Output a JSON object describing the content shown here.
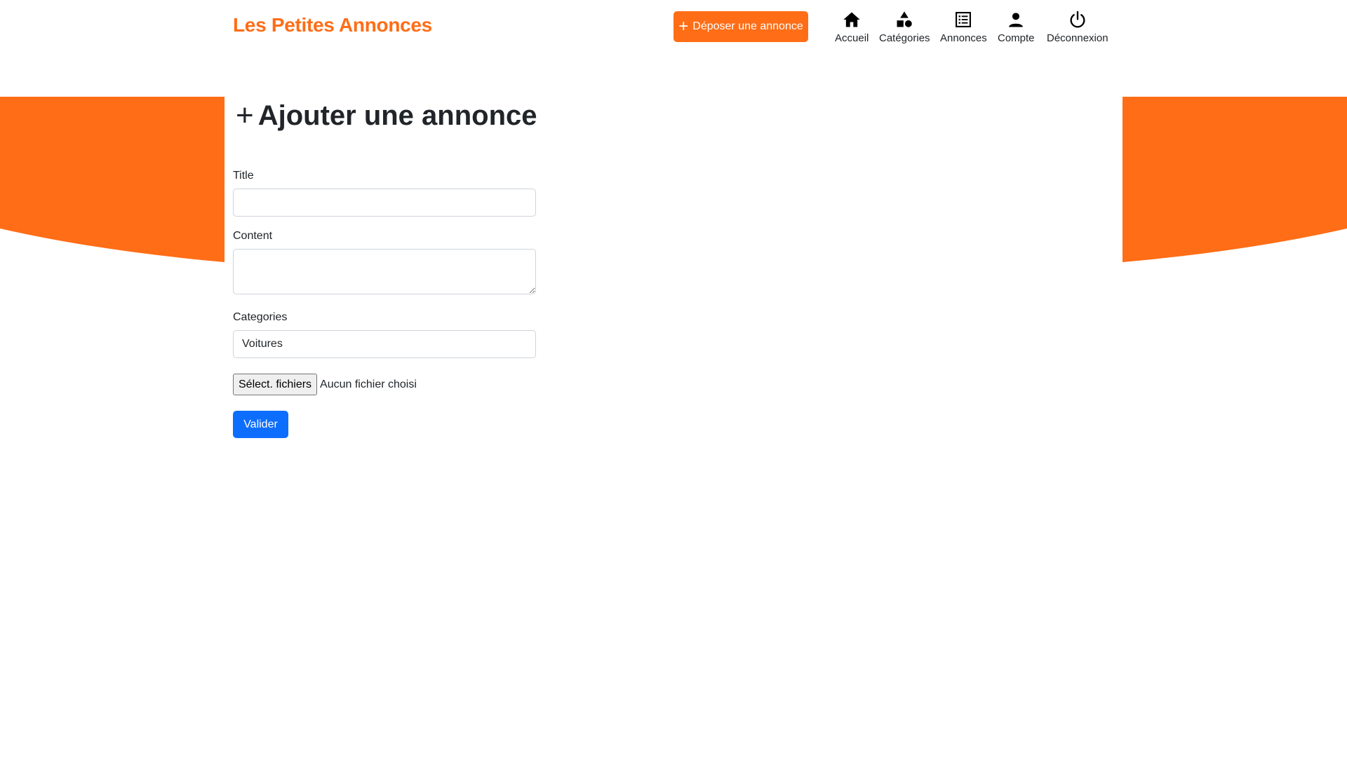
{
  "header": {
    "brand": "Les Petites Annonces",
    "deposit_button": {
      "icon": "plus-icon",
      "label": "Déposer une annonce"
    },
    "nav": [
      {
        "icon": "home-icon",
        "label": "Accueil"
      },
      {
        "icon": "shapes-icon",
        "label": "Catégories"
      },
      {
        "icon": "list-icon",
        "label": "Annonces"
      },
      {
        "icon": "user-icon",
        "label": "Compte"
      },
      {
        "icon": "power-icon",
        "label": "Déconnexion"
      }
    ]
  },
  "page": {
    "title_icon": "plus-icon",
    "title": "Ajouter une annonce"
  },
  "form": {
    "title_label": "Title",
    "title_value": "",
    "content_label": "Content",
    "content_value": "",
    "categories_label": "Categories",
    "categories_selected": "Voitures",
    "file_button": "Sélect. fichiers",
    "file_status": "Aucun fichier choisi",
    "submit": "Valider"
  },
  "colors": {
    "accent": "#ff6d16",
    "primary": "#0d6efd",
    "text": "#212529"
  }
}
